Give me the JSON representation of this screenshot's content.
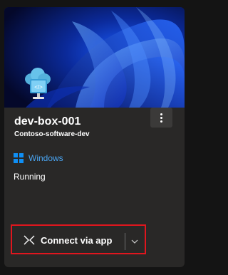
{
  "card": {
    "name": "dev-box-001",
    "project": "Contoso-software-dev",
    "os": "Windows",
    "status": "Running",
    "more_menu_icon": "more-vertical-icon"
  },
  "actions": {
    "connect_label": "Connect via app",
    "connect_icon": "remote-connect-icon",
    "dropdown_icon": "chevron-down-icon"
  },
  "colors": {
    "card_background": "#292827",
    "accent_link": "#4aa5f2",
    "windows_logo": "#0f8ff5",
    "highlight_border": "#e0161e"
  }
}
